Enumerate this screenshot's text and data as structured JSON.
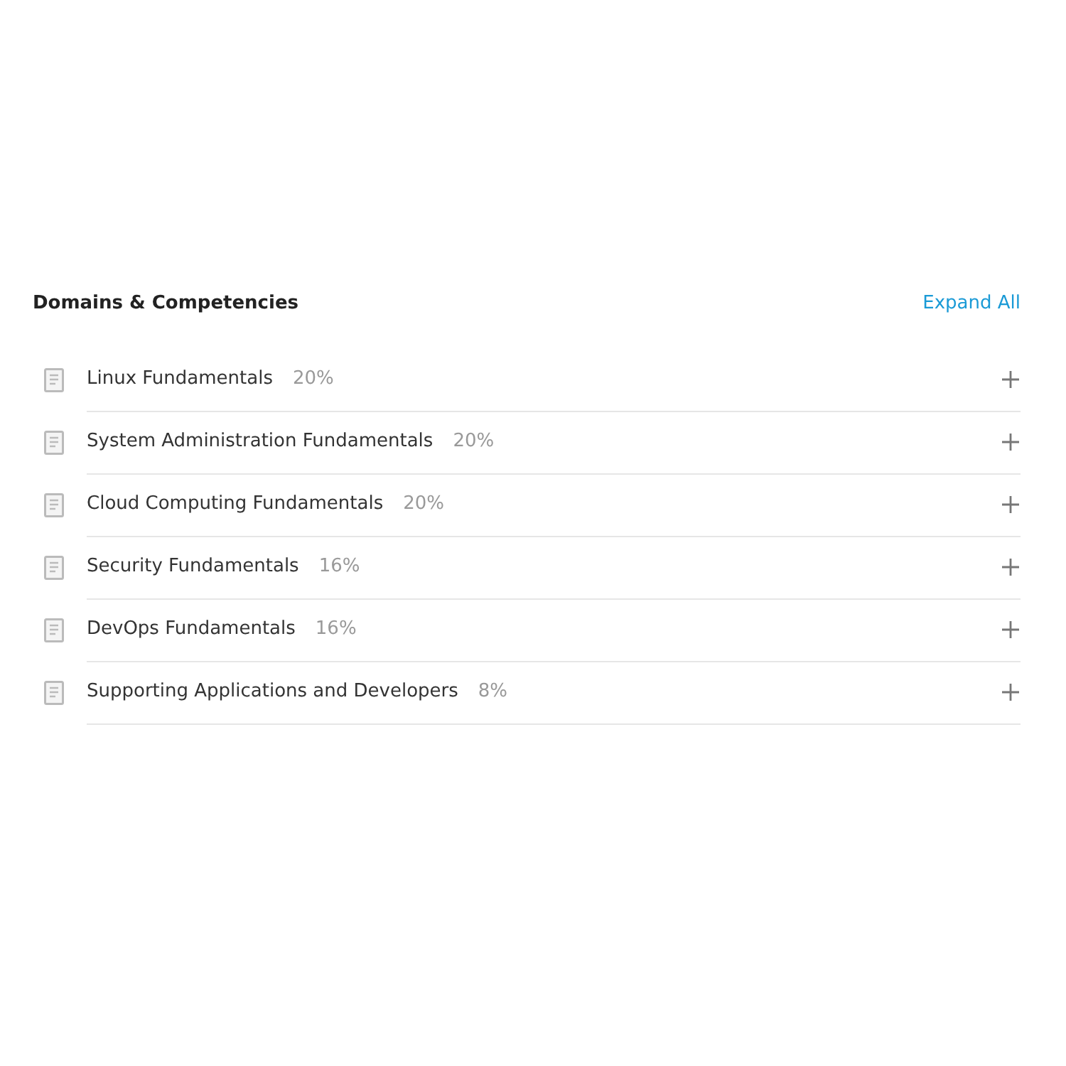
{
  "section": {
    "title": "Domains & Competencies",
    "expand_all": "Expand All"
  },
  "domains": [
    {
      "name": "Linux Fundamentals",
      "weight": "20%",
      "expanded": false
    },
    {
      "name": "System Administration Fundamentals",
      "weight": "20%",
      "expanded": false
    },
    {
      "name": "Cloud Computing Fundamentals",
      "weight": "20%",
      "expanded": false
    },
    {
      "name": "Security Fundamentals",
      "weight": "16%",
      "expanded": false
    },
    {
      "name": "DevOps Fundamentals",
      "weight": "16%",
      "expanded": false
    },
    {
      "name": "Supporting Applications and Developers",
      "weight": "8%",
      "expanded": false
    }
  ]
}
